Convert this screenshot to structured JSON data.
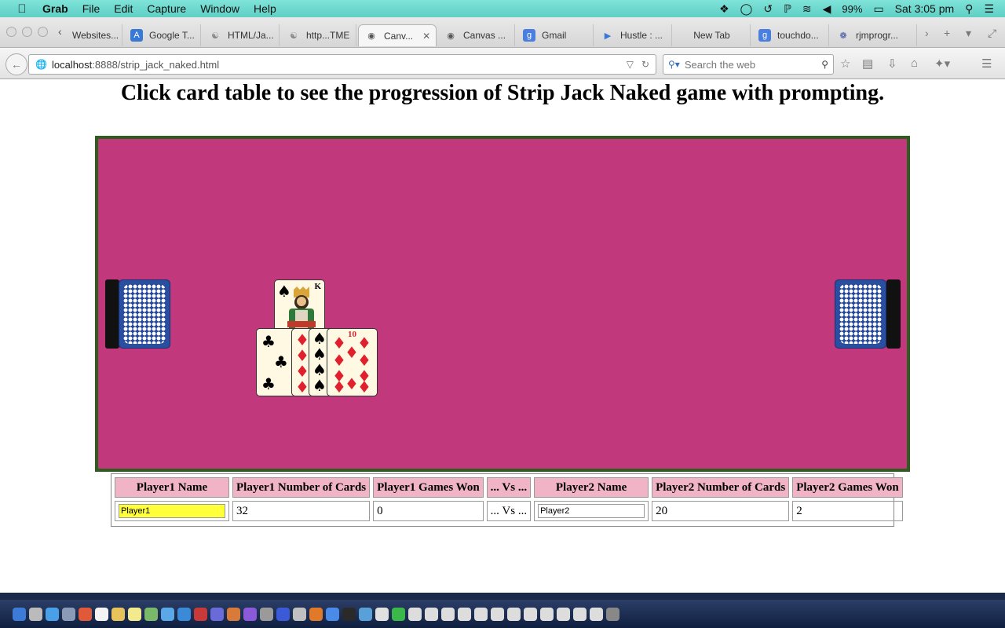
{
  "menubar": {
    "app": "Grab",
    "items": [
      "File",
      "Edit",
      "Capture",
      "Window",
      "Help"
    ],
    "battery": "99%",
    "clock": "Sat 3:05 pm"
  },
  "tabs": [
    {
      "label": "Websites...",
      "icon": "page-icon"
    },
    {
      "label": "Google T...",
      "icon": "translate-icon"
    },
    {
      "label": "HTML/Ja...",
      "icon": "page-icon"
    },
    {
      "label": "http...TME",
      "icon": "page-icon"
    },
    {
      "label": "Canv...",
      "icon": "globe-icon",
      "active": true
    },
    {
      "label": "Canvas ...",
      "icon": "globe-icon"
    },
    {
      "label": "Gmail",
      "icon": "google-icon"
    },
    {
      "label": "Hustle : ...",
      "icon": "video-icon"
    },
    {
      "label": "New Tab",
      "icon": ""
    },
    {
      "label": "touchdo...",
      "icon": "google-icon"
    },
    {
      "label": "rjmprogr...",
      "icon": "site-icon"
    }
  ],
  "navbar": {
    "url_host": "localhost",
    "url_path": ":8888/strip_jack_naked.html",
    "search_placeholder": "Search the web"
  },
  "page": {
    "heading": "Click card table to see the progression of Strip Jack Naked game with prompting.",
    "table_color": "#c1387c",
    "table_border": "#2f5c1f"
  },
  "cards_in_play": [
    {
      "rank": "K",
      "suit": "spades"
    },
    {
      "rank": "3",
      "suit": "clubs"
    },
    {
      "rank": "8",
      "suit": "diamonds"
    },
    {
      "rank": "7",
      "suit": "spades"
    },
    {
      "rank": "10",
      "suit": "diamonds"
    }
  ],
  "stats": {
    "headers": [
      "Player1 Name",
      "Player1 Number of Cards",
      "Player1 Games Won",
      "... Vs ...",
      "Player2 Name",
      "Player2 Number of Cards",
      "Player2 Games Won"
    ],
    "player1_name": "Player1",
    "player1_cards": "32",
    "player1_won": "0",
    "vs": "... Vs ...",
    "player2_name": "Player2",
    "player2_cards": "20",
    "player2_won": "2"
  }
}
